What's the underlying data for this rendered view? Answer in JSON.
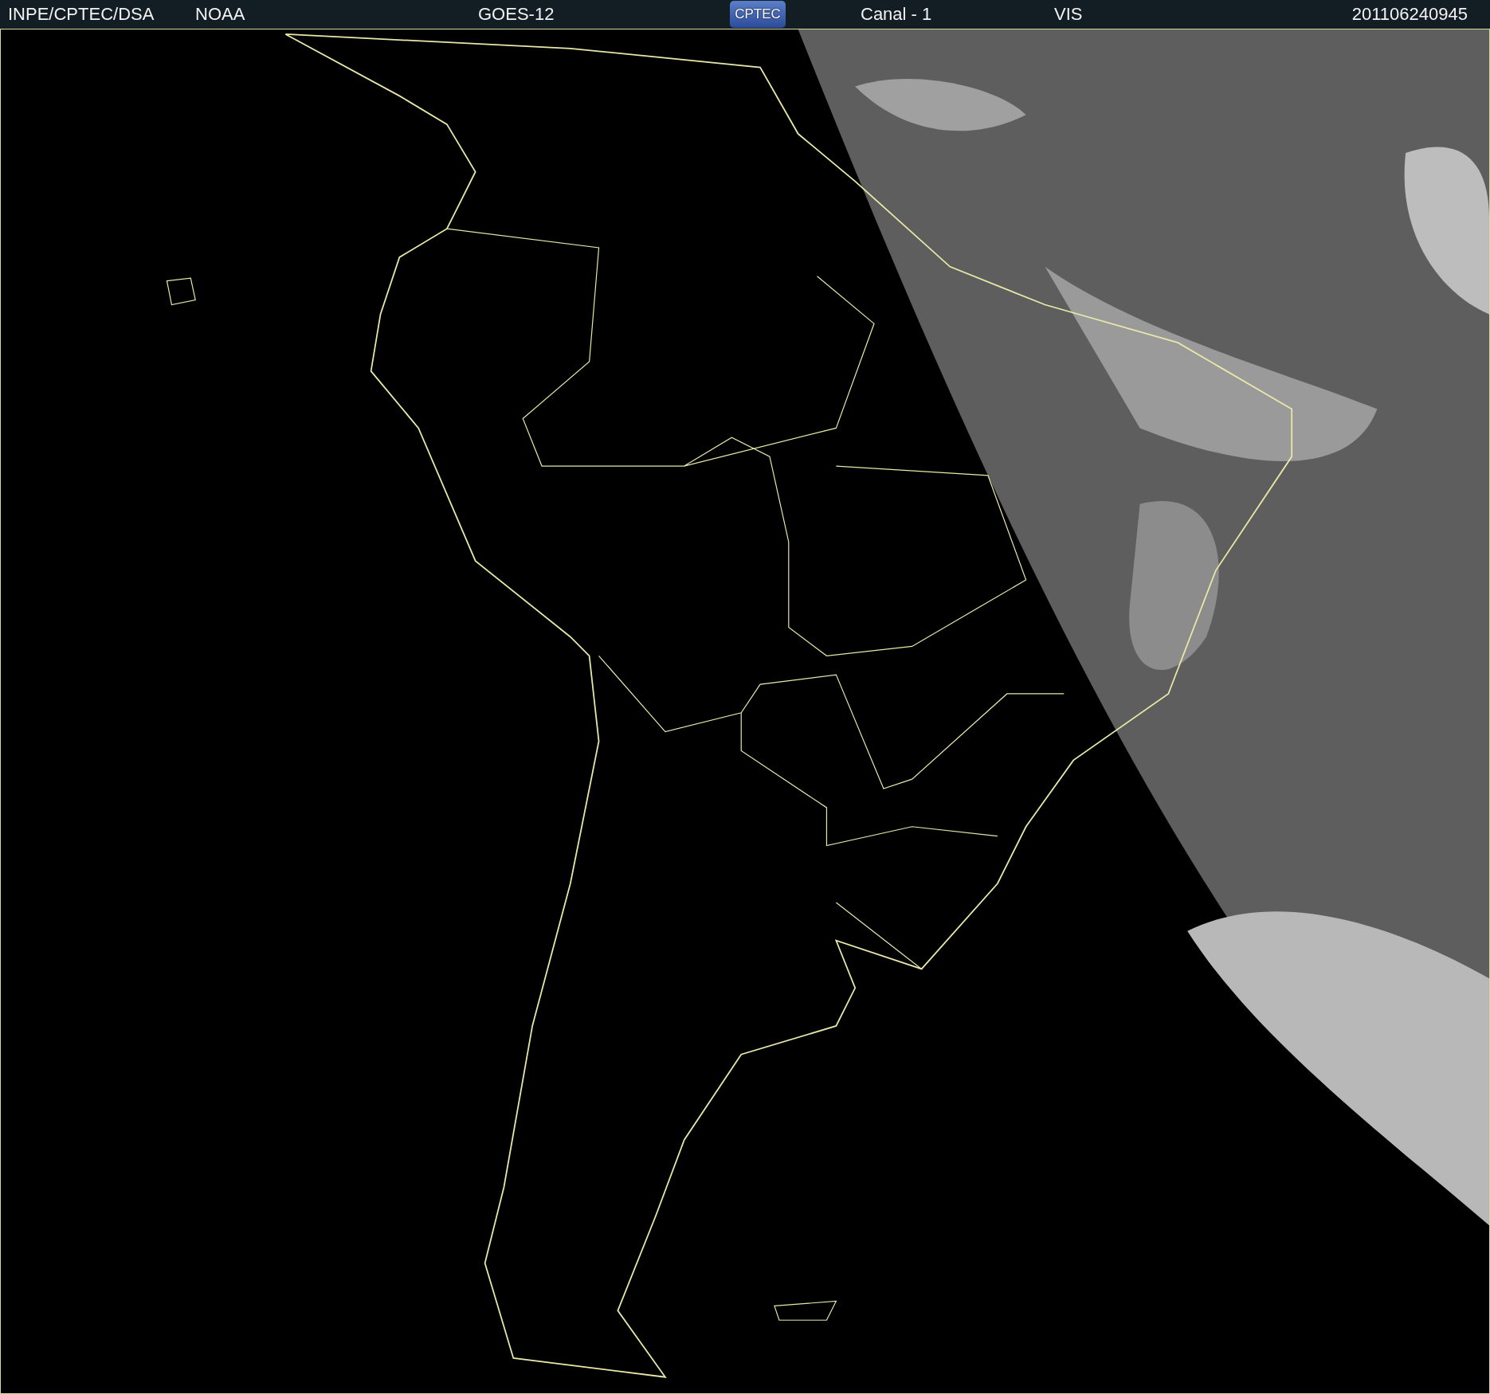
{
  "header": [
    {
      "kind": "text",
      "text": "INPE/CPTEC/DSA"
    },
    {
      "kind": "text",
      "text": "NOAA"
    },
    {
      "kind": "text",
      "text": "GOES-12"
    },
    {
      "kind": "logo",
      "text": "CPTEC"
    },
    {
      "kind": "text",
      "text": "Canal - 1"
    },
    {
      "kind": "text",
      "text": "VIS"
    },
    {
      "kind": "text",
      "text": "201106240945"
    }
  ]
}
